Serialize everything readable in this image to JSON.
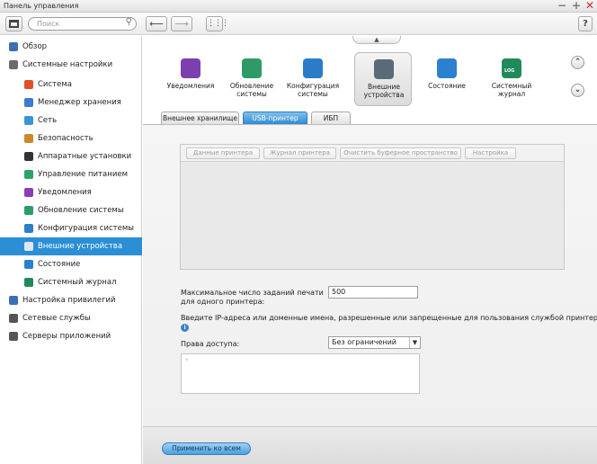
{
  "window": {
    "title": "Панель управления"
  },
  "toolbar": {
    "search_placeholder": "Поиск",
    "help": "?"
  },
  "sidebar": {
    "items": [
      {
        "label": "Обзор",
        "level": "top",
        "icon": "overview-icon",
        "color": "#3b6fb0",
        "active": false
      },
      {
        "label": "Системные настройки",
        "level": "top",
        "icon": "gear-icon",
        "color": "#6b6b6b",
        "active": false
      },
      {
        "label": "Система",
        "level": "sub",
        "icon": "system-icon",
        "color": "#e0512a",
        "active": false
      },
      {
        "label": "Менеджер хранения",
        "level": "sub",
        "icon": "storage-icon",
        "color": "#3d7ad1",
        "active": false
      },
      {
        "label": "Сеть",
        "level": "sub",
        "icon": "network-icon",
        "color": "#3a95d8",
        "active": false
      },
      {
        "label": "Безопасность",
        "level": "sub",
        "icon": "lock-icon",
        "color": "#c98a2a",
        "active": false
      },
      {
        "label": "Аппаратные установки",
        "level": "sub",
        "icon": "hardware-icon",
        "color": "#333333",
        "active": false
      },
      {
        "label": "Управление питанием",
        "level": "sub",
        "icon": "bulb-icon",
        "color": "#2ea36a",
        "active": false
      },
      {
        "label": "Уведомления",
        "level": "sub",
        "icon": "notification-icon",
        "color": "#8a3fb8",
        "active": false
      },
      {
        "label": "Обновление системы",
        "level": "sub",
        "icon": "update-icon",
        "color": "#2a9c6c",
        "active": false
      },
      {
        "label": "Конфигурация системы",
        "level": "sub",
        "icon": "config-icon",
        "color": "#2b7fc9",
        "active": false
      },
      {
        "label": "Внешние устройства",
        "level": "sub",
        "icon": "external-device-icon",
        "color": "#dfe8f2",
        "active": true
      },
      {
        "label": "Состояние",
        "level": "sub",
        "icon": "monitor-icon",
        "color": "#2a7fd0",
        "active": false
      },
      {
        "label": "Системный журнал",
        "level": "sub",
        "icon": "log-icon",
        "color": "#1f8a5a",
        "active": false
      },
      {
        "label": "Настройка привилегий",
        "level": "top",
        "icon": "user-icon",
        "color": "#3a6fb5",
        "active": false
      },
      {
        "label": "Сетевые службы",
        "level": "top",
        "icon": "network-services-icon",
        "color": "#555555",
        "active": false
      },
      {
        "label": "Серверы приложений",
        "level": "top",
        "icon": "app-server-icon",
        "color": "#555555",
        "active": false
      }
    ]
  },
  "apps": [
    {
      "label": "Уведомления",
      "icon": "notification-app-icon",
      "color": "#7c3fb0",
      "selected": false
    },
    {
      "label": "Обновление системы",
      "icon": "update-app-icon",
      "color": "#2f9a66",
      "selected": false
    },
    {
      "label": "Конфигурация системы",
      "icon": "config-app-icon",
      "color": "#2b7cc8",
      "selected": false
    },
    {
      "label": "Внешние устройства",
      "icon": "external-device-app-icon",
      "color": "#5b6a78",
      "selected": true
    },
    {
      "label": "Состояние",
      "icon": "status-app-icon",
      "color": "#2b80d0",
      "selected": false
    },
    {
      "label": "Системный журнал",
      "icon": "log-app-icon",
      "color": "#1f8a5a",
      "badge": "LOG",
      "selected": false
    }
  ],
  "tabs": [
    {
      "label": "Внешнее хранилище",
      "active": false
    },
    {
      "label": "USB-принтер",
      "active": true
    },
    {
      "label": "ИБП",
      "active": false
    }
  ],
  "printer_buttons": [
    "Данные принтера",
    "Журнал принтера",
    "Очистить буферное пространство",
    "Настройка"
  ],
  "form": {
    "max_jobs_label": "Максимальное число заданий печати для одного принтера:",
    "max_jobs_value": "500",
    "ip_label": "Введите IP-адреса или доменные имена, разрешенные или запрещенные для пользования службой принтера:",
    "access_label": "Права доступа:",
    "access_value": "Без ограничений"
  },
  "footer": {
    "apply_label": "Применить ко всем"
  },
  "colors": {
    "accent": "#2b8fd6",
    "close": "#d12a2a"
  }
}
